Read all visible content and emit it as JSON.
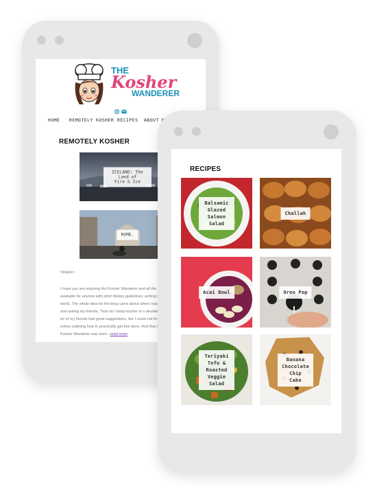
{
  "back_site": {
    "logo": {
      "the": "THE",
      "kosher": "Kosher",
      "wanderer": "WANDERER"
    },
    "social_icons": [
      "instagram-icon",
      "email-icon"
    ],
    "nav": [
      "HOME",
      "REMOTELY KOSHER",
      "RECIPES",
      "ABOUT ME"
    ],
    "section_title": "REMOTELY KOSHER",
    "posts": [
      {
        "label": "ICELAND: The Land of\nFire & Ice"
      },
      {
        "label": "ROME."
      }
    ],
    "greeting": "Shalom~",
    "body_lines": [
      "I hope you are enjoying the Kosher Wanderer and all the info",
      "available for anyone with strict dietary guidelines, aching to t",
      "world. The whole idea for the blog came about when I was",
      "and asking my friends, \"how do I keep kosher in a desolate",
      "lot of my friends had great suggestions, but I could not find",
      "online outlining how to practically get this done. And that is",
      "Kosher Wanderer was born..."
    ],
    "read_more": "read more"
  },
  "front_site": {
    "section_title": "RECIPES",
    "recipes": [
      {
        "label": "Balsamic\nGlazed Salmon\nSalad"
      },
      {
        "label": "Challah"
      },
      {
        "label": "Acai Bowl"
      },
      {
        "label": "Oreo Pop"
      },
      {
        "label": "Teriyaki Tofu &\nRoasted Veggie\nSalad"
      },
      {
        "label": "Banana\nChocolate Chip\nCake"
      }
    ]
  },
  "colors": {
    "brand_blue": "#1a8fb8",
    "brand_pink": "#e0457b",
    "phone_frame": "#e8e8e8",
    "link": "#7b3aa8"
  }
}
